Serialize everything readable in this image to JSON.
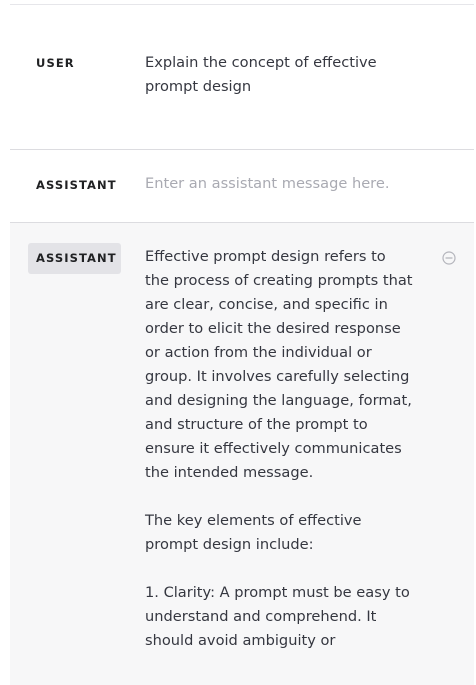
{
  "messages": {
    "user": {
      "role": "USER",
      "text": "Explain the concept of effective prompt design"
    },
    "draft": {
      "role": "ASSISTANT",
      "placeholder": "Enter an assistant message here."
    },
    "reply": {
      "role": "ASSISTANT",
      "text": "Effective prompt design refers to the process of creating prompts that are clear, concise, and specific in order to elicit the desired response or action from the individual or group. It involves carefully selecting and designing the language, format, and structure of the prompt to ensure it effectively communicates the intended message.\n\nThe key elements of effective prompt design include:\n\n1. Clarity: A prompt must be easy to understand and comprehend. It should avoid ambiguity or",
      "remove_icon": "minus-circle-icon"
    }
  },
  "colors": {
    "selected_role_bg": "#e3e3e7",
    "reply_bg": "#f7f7f8",
    "placeholder": "#a9aab2",
    "divider": "#dcdce0"
  }
}
